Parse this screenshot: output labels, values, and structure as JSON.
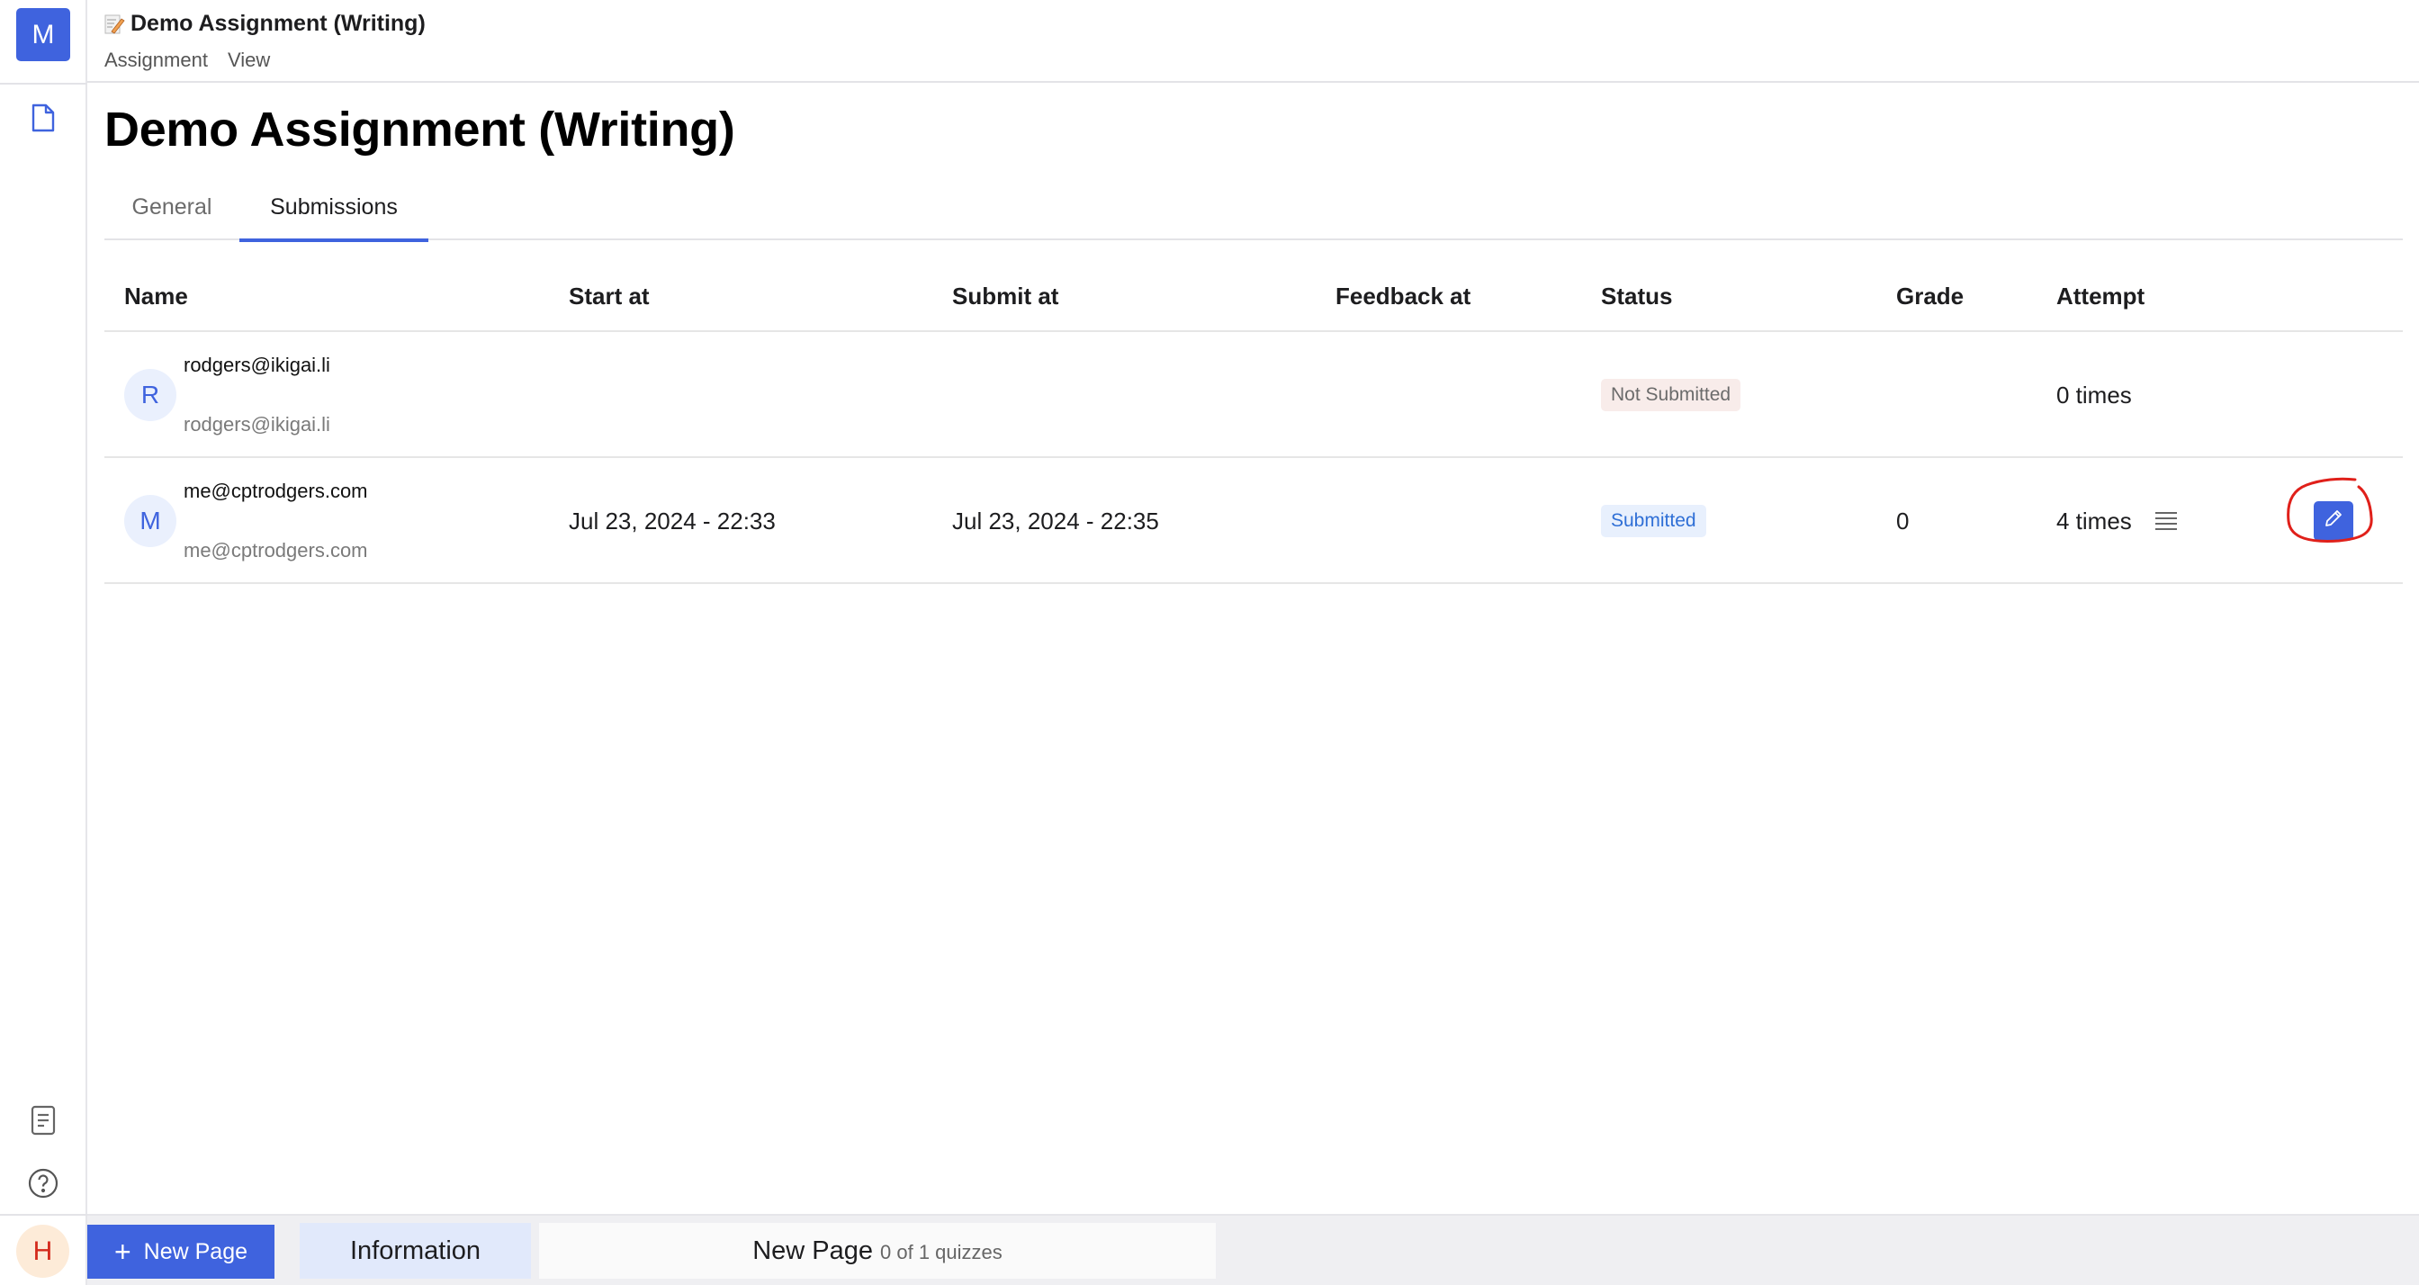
{
  "app": {
    "logo_letter": "M",
    "user_initial": "H"
  },
  "header": {
    "title": "Demo Assignment (Writing)",
    "title_icon": "memo-icon",
    "menu": [
      "Assignment",
      "View"
    ]
  },
  "sidebar": {
    "icons": [
      "document-icon",
      "notes-icon",
      "help-icon"
    ]
  },
  "page": {
    "title": "Demo Assignment (Writing)",
    "tabs": [
      {
        "label": "General",
        "active": false
      },
      {
        "label": "Submissions",
        "active": true
      }
    ]
  },
  "table": {
    "columns": [
      "Name",
      "Start at",
      "Submit at",
      "Feedback at",
      "Status",
      "Grade",
      "Attempt"
    ],
    "rows": [
      {
        "avatar": "R",
        "name": "rodgers@ikigai.li",
        "email": "rodgers@ikigai.li",
        "start_at": "",
        "submit_at": "",
        "feedback_at": "",
        "status": "Not Submitted",
        "grade": "",
        "attempt": "0 times",
        "has_actions": false
      },
      {
        "avatar": "M",
        "name": "me@cptrodgers.com",
        "email": "me@cptrodgers.com",
        "start_at": "Jul 23, 2024 - 22:33",
        "submit_at": "Jul 23, 2024 - 22:35",
        "feedback_at": "",
        "status": "Submitted",
        "grade": "0",
        "attempt": "4 times",
        "has_actions": true
      }
    ]
  },
  "footer": {
    "new_page_label": "New Page",
    "tabs": [
      {
        "label": "Information"
      },
      {
        "label": "New Page",
        "sub": "0 of 1 quizzes"
      }
    ]
  },
  "colors": {
    "accent": "#3f63de",
    "status_submitted_bg": "#e8f0fd",
    "status_submitted_fg": "#2f6fd6",
    "status_not_submitted_bg": "#f8ecea",
    "status_not_submitted_fg": "#6b6b6b",
    "annotation": "#e0201a"
  }
}
